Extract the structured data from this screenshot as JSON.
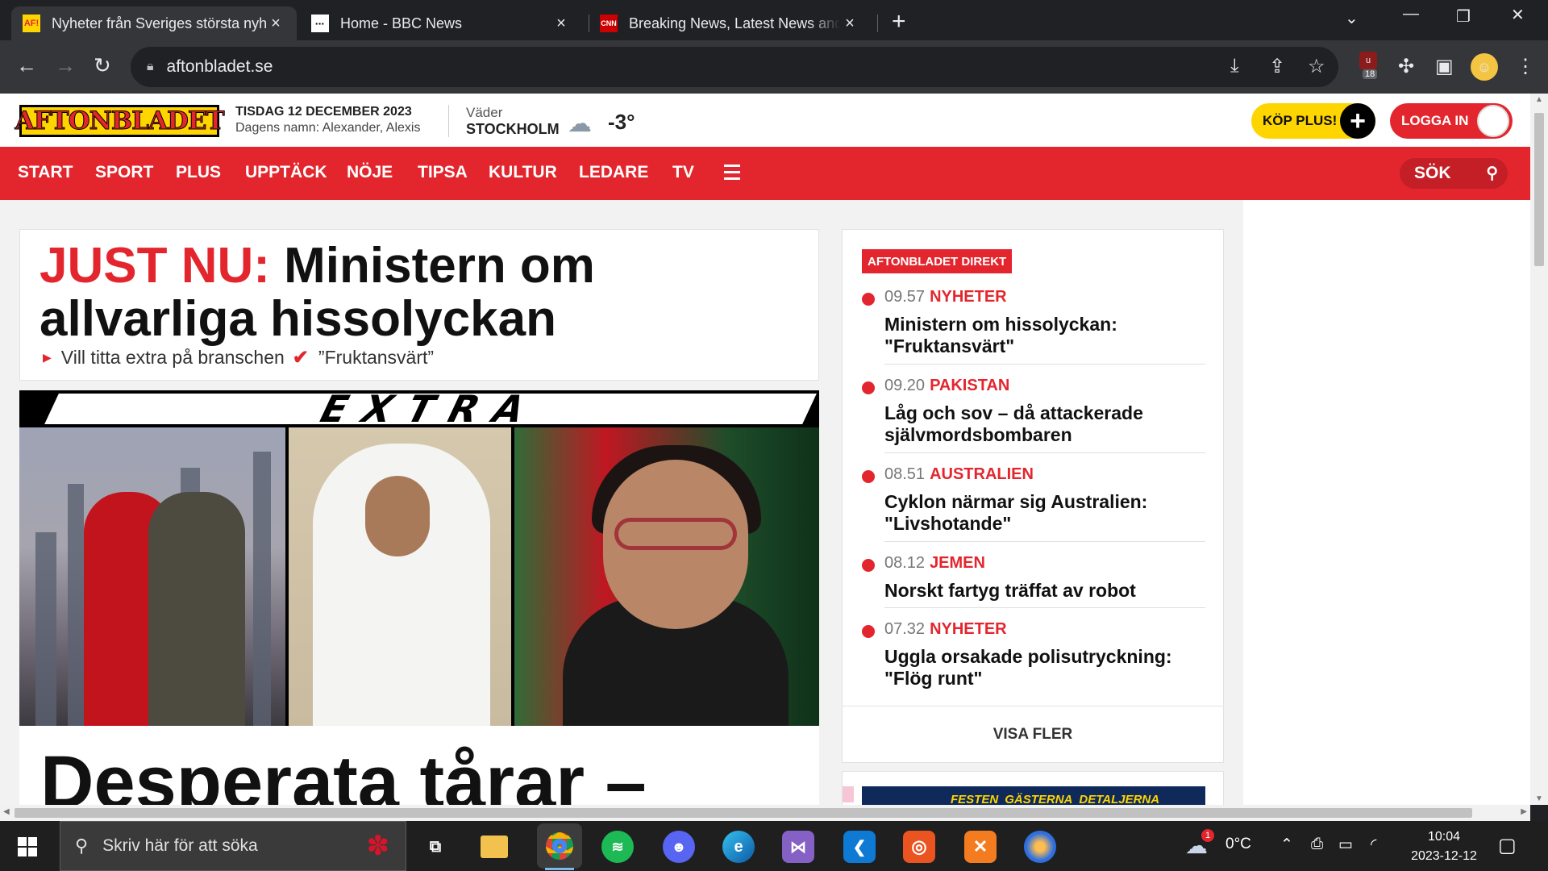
{
  "browser": {
    "tabs": [
      {
        "title": "Nyheter från Sveriges största nyh",
        "favicon": "AF!",
        "active": true
      },
      {
        "title": "Home - BBC News",
        "favicon": "BBC",
        "active": false
      },
      {
        "title": "Breaking News, Latest News and",
        "favicon": "CNN",
        "active": false
      }
    ],
    "url": "aftonbladet.se",
    "extension_badge": "18"
  },
  "site": {
    "logo": "AFTONBLADET",
    "date": "TISDAG 12 DECEMBER 2023",
    "names": "Dagens namn: Alexander, Alexis",
    "weather_label": "Väder",
    "weather_city": "STOCKHOLM",
    "weather_temp": "-3°",
    "buy_plus": "KÖP PLUS!",
    "login": "LOGGA IN",
    "nav": [
      "START",
      "SPORT",
      "PLUS",
      "UPPTÄCK",
      "NÖJE",
      "TIPSA",
      "KULTUR",
      "LEDARE",
      "TV"
    ],
    "search": "SÖK"
  },
  "lead": {
    "kicker": "JUST NU:",
    "title": " Ministern om allvarliga hissolyckan",
    "sub1": "Vill titta extra på branschen",
    "sub2": "”Fruktansvärt”"
  },
  "extra": {
    "banner": "EXTRA",
    "headline": "Desperata tårar –"
  },
  "direkt": {
    "badge": "AFTONBLADET DIREKT",
    "items": [
      {
        "time": "09.57",
        "category": "NYHETER",
        "headline": "Ministern om hissolyckan: \"Fruktansvärt\""
      },
      {
        "time": "09.20",
        "category": "PAKISTAN",
        "headline": "Låg och sov – då attackerade självmordsbombaren"
      },
      {
        "time": "08.51",
        "category": "AUSTRALIEN",
        "headline": "Cyklon närmar sig Australien: \"Livshotande\""
      },
      {
        "time": "08.12",
        "category": "JEMEN",
        "headline": "Norskt fartyg träffat av robot"
      },
      {
        "time": "07.32",
        "category": "NYHETER",
        "headline": "Uggla orsakade polisutryckning: \"Flög runt\""
      }
    ],
    "more": "VISA FLER"
  },
  "festen": {
    "labels": [
      "FESTEN",
      "GÄSTERNA",
      "DETALJERNA"
    ]
  },
  "taskbar": {
    "search_placeholder": "Skriv här för att söka",
    "weather": "0°C",
    "weather_badge": "1",
    "time": "10:04",
    "date": "2023-12-12"
  },
  "colors": {
    "brand_red": "#e3262e",
    "brand_yellow": "#ffd500"
  }
}
